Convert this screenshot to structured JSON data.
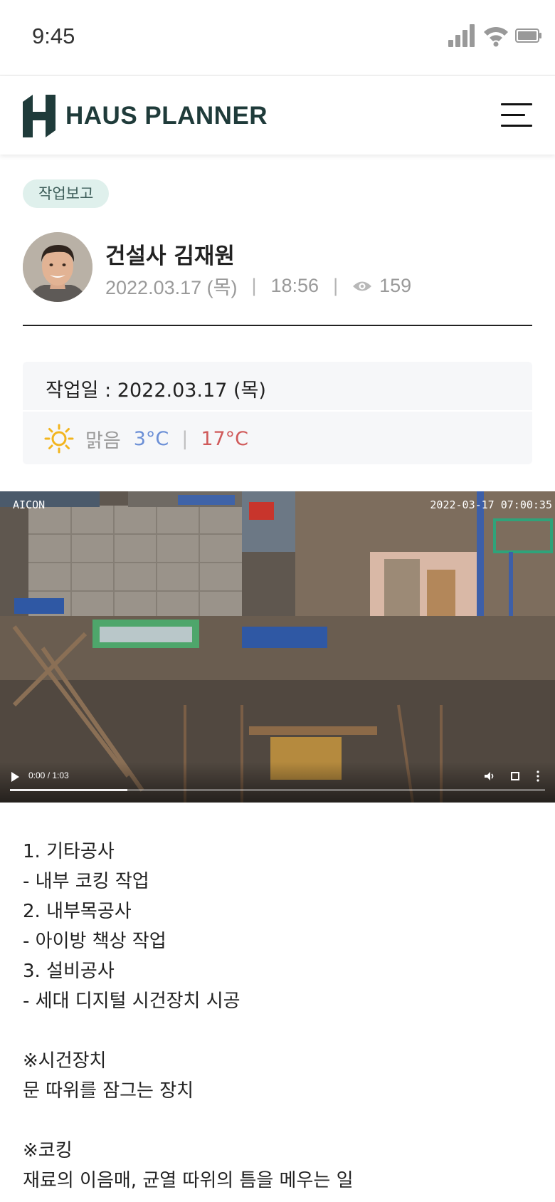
{
  "status_bar": {
    "time": "9:45",
    "icons": [
      "signal-icon",
      "wifi-icon",
      "battery-icon"
    ]
  },
  "header": {
    "brand": "HAUS PLANNER",
    "logo_icon": "h-logo-icon",
    "menu_icon": "hamburger-menu-icon",
    "colors": {
      "brand": "#1f3b3a"
    }
  },
  "post": {
    "category": "작업보고",
    "author": "건설사 김재원",
    "date": "2022.03.17 (목)",
    "time": "18:56",
    "views": "159"
  },
  "work_info": {
    "work_date": "작업일 : 2022.03.17 (목)",
    "weather": "맑음",
    "weather_icon": "sun-icon",
    "temp_low": "3°C",
    "temp_high": "17°C",
    "colors": {
      "low": "#6b8fd6",
      "high": "#d05a5a",
      "sun": "#f2b51e"
    }
  },
  "video": {
    "overlay_left": "AICON",
    "overlay_right": "2022-03-17 07:00:35",
    "time": "0:00 / 1:03",
    "progress": 0.22
  },
  "content_lines": [
    "1. 기타공사",
    "- 내부 코킹 작업",
    "2. 내부목공사",
    "- 아이방 책상 작업",
    "3. 설비공사",
    "- 세대 디지털 시건장치 시공",
    "",
    "※시건장치",
    "문 따위를 잠그는 장치",
    "",
    "※코킹",
    "재료의 이음매, 균열 따위의 틈을 메우는 일"
  ]
}
